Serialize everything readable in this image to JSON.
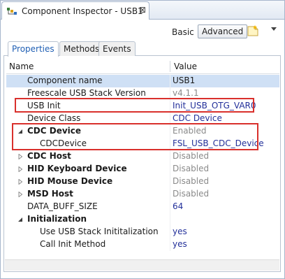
{
  "window": {
    "title": "Component Inspector - USB1",
    "close_glyph": "⊠"
  },
  "toolbar": {
    "basic_label": "Basic",
    "advanced_label": "Advanced"
  },
  "tabs": [
    {
      "label": "Properties",
      "active": true
    },
    {
      "label": "Methods",
      "active": false
    },
    {
      "label": "Events",
      "active": false
    }
  ],
  "table": {
    "headers": {
      "name": "Name",
      "value": "Value"
    },
    "rows": [
      {
        "name": "Component name",
        "value": "USB1",
        "bold": false,
        "arrow": "",
        "indent": 1,
        "value_style": "normal",
        "selected": true
      },
      {
        "name": "Freescale USB Stack Version",
        "value": "v4.1.1",
        "bold": false,
        "arrow": "",
        "indent": 1,
        "value_style": "grey"
      },
      {
        "name": "USB Init",
        "value": "Init_USB_OTG_VAR0",
        "bold": false,
        "arrow": "",
        "indent": 1,
        "value_style": "blue"
      },
      {
        "name": "Device Class",
        "value": "CDC Device",
        "bold": false,
        "arrow": "",
        "indent": 1,
        "value_style": "blue"
      },
      {
        "name": "CDC Device",
        "value": "Enabled",
        "bold": true,
        "arrow": "expanded",
        "indent": 1,
        "value_style": "grey"
      },
      {
        "name": "CDCDevice",
        "value": "FSL_USB_CDC_Device",
        "bold": false,
        "arrow": "",
        "indent": 2,
        "value_style": "blue"
      },
      {
        "name": "CDC Host",
        "value": "Disabled",
        "bold": true,
        "arrow": "collapsed",
        "indent": 1,
        "value_style": "grey"
      },
      {
        "name": "HID Keyboard Device",
        "value": "Disabled",
        "bold": true,
        "arrow": "collapsed",
        "indent": 1,
        "value_style": "grey"
      },
      {
        "name": "HID Mouse Device",
        "value": "Disabled",
        "bold": true,
        "arrow": "collapsed",
        "indent": 1,
        "value_style": "grey"
      },
      {
        "name": "MSD Host",
        "value": "Disabled",
        "bold": true,
        "arrow": "collapsed",
        "indent": 1,
        "value_style": "grey"
      },
      {
        "name": "DATA_BUFF_SIZE",
        "value": "64",
        "bold": false,
        "arrow": "",
        "indent": 1,
        "value_style": "blue"
      },
      {
        "name": "Initialization",
        "value": "",
        "bold": true,
        "arrow": "expanded",
        "indent": 1,
        "value_style": "normal"
      },
      {
        "name": "Use USB Stack Inititalization",
        "value": "yes",
        "bold": false,
        "arrow": "",
        "indent": 2,
        "value_style": "blue"
      },
      {
        "name": "Call Init Method",
        "value": "yes",
        "bold": false,
        "arrow": "",
        "indent": 2,
        "value_style": "blue"
      }
    ]
  },
  "colors": {
    "highlight_box": "#d9302c",
    "selection": "#cfe0f5",
    "value_blue": "#23309a",
    "value_grey": "#8a8a8a"
  }
}
